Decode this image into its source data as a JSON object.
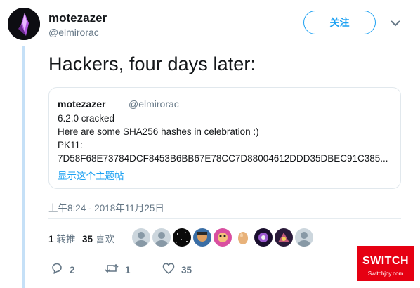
{
  "author": {
    "display_name": "motezazer",
    "handle": "@elmirorac"
  },
  "follow_label": "关注",
  "tweet_text": "Hackers, four days later:",
  "quote": {
    "display_name": "motezazer",
    "handle": "@elmirorac",
    "lines": [
      "6.2.0 cracked",
      "Here are some SHA256 hashes in celebration :)",
      "PK11:",
      "7D58F68E73784DCF8453B6BB67E78CC7D88004612DDD35DBEC91C385..."
    ],
    "show_thread": "显示这个主题帖"
  },
  "timestamp": "上午8:24 - 2018年11月25日",
  "stats": {
    "retweets_count": "1",
    "retweets_label": "转推",
    "likes_count": "35",
    "likes_label": "喜欢"
  },
  "actions": {
    "reply_count": "2",
    "retweet_count": "1",
    "like_count": "35"
  },
  "watermark": {
    "main": "SWITCH",
    "sub": "Switchjoy.com"
  },
  "colors": {
    "accent": "#1da1f2",
    "muted": "#657786",
    "text": "#14171a",
    "watermark": "#e60012"
  }
}
